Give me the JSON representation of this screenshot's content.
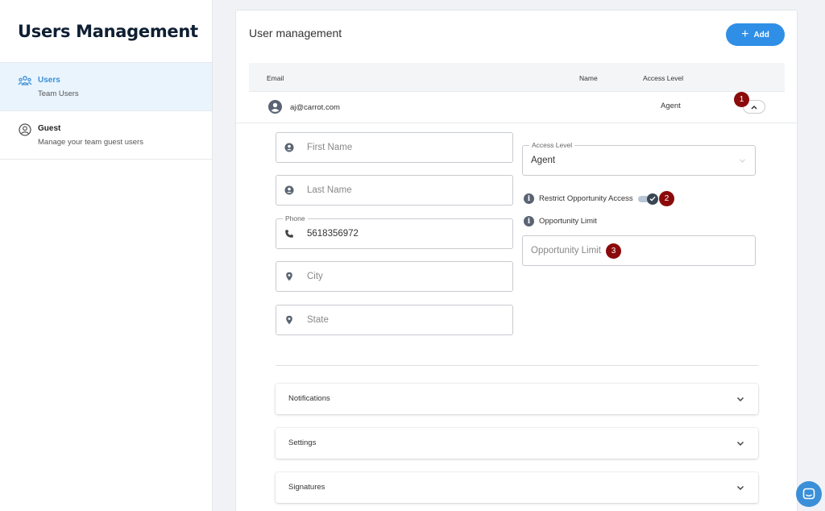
{
  "sidebar": {
    "title": "Users Management",
    "items": [
      {
        "label": "Users",
        "sub": "Team Users",
        "icon": "users-icon",
        "active": true
      },
      {
        "label": "Guest",
        "sub": "Manage your team guest users",
        "icon": "guest-icon",
        "active": false
      }
    ]
  },
  "main": {
    "title": "User management",
    "add_label": "Add",
    "columns": {
      "email": "Email",
      "name": "Name",
      "access": "Access Level"
    },
    "row": {
      "email": "aj@carrot.com",
      "access_level": "Agent"
    },
    "form": {
      "first_name_placeholder": "First Name",
      "last_name_placeholder": "Last Name",
      "phone_label": "Phone",
      "phone_value": "5618356972",
      "city_placeholder": "City",
      "state_placeholder": "State",
      "access_level_label": "Access Level",
      "access_level_value": "Agent",
      "restrict_label": "Restrict Opportunity Access",
      "restrict_on": true,
      "opp_limit_label": "Opportunity Limit",
      "opp_limit_placeholder": "Opportunity Limit"
    },
    "sections": [
      "Notifications",
      "Settings",
      "Signatures"
    ]
  },
  "badges": [
    "1",
    "2",
    "3"
  ],
  "colors": {
    "accent": "#2f8fe6",
    "badge": "#8b0a0a",
    "active_bg": "#eaf4fd"
  }
}
